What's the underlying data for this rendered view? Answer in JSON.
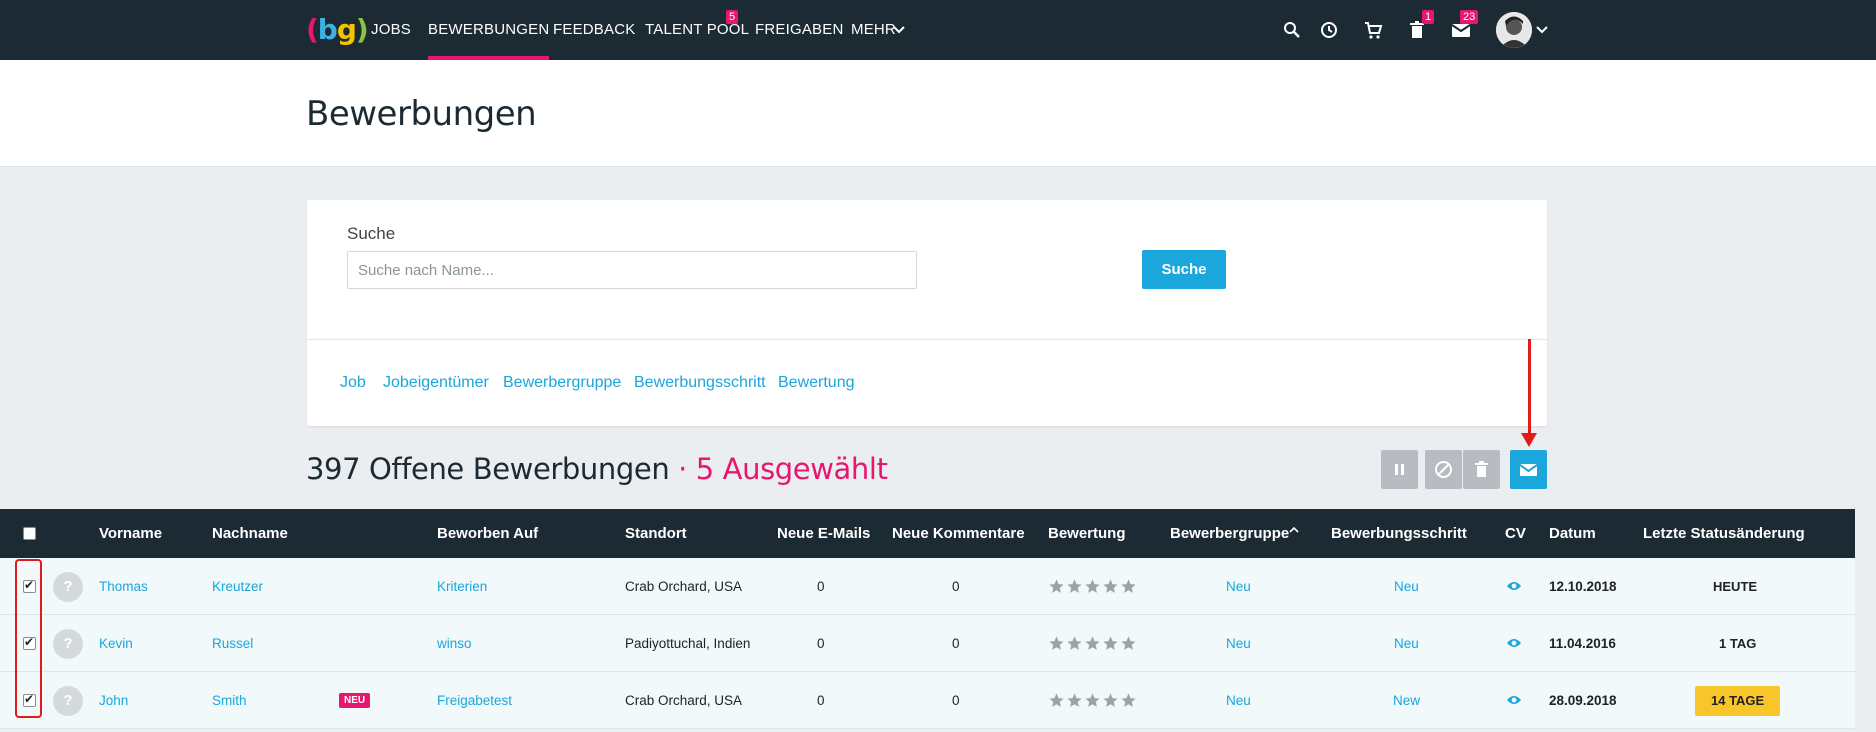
{
  "nav": {
    "items": [
      {
        "label": "JOBS",
        "active": false
      },
      {
        "label": "BEWERBUNGEN",
        "active": true
      },
      {
        "label": "FEEDBACK",
        "active": false
      },
      {
        "label": "TALENT POOL",
        "active": false,
        "badge": "5"
      },
      {
        "label": "FREIGABEN",
        "active": false
      },
      {
        "label": "MEHR",
        "active": false
      }
    ],
    "icons": [
      "search-icon",
      "clock-icon",
      "cart-icon",
      "trash-icon",
      "mail-icon",
      "avatar",
      "chevron-down-icon"
    ],
    "trash_badge": "1",
    "mail_badge": "23",
    "accent": "#e6176f",
    "bg": "#1c2b33"
  },
  "page": {
    "title": "Bewerbungen"
  },
  "search": {
    "label": "Suche",
    "placeholder": "Suche nach Name...",
    "button": "Suche"
  },
  "filters": [
    "Job",
    "Jobeigentümer",
    "Bewerbergruppe",
    "Bewerbungsschritt",
    "Bewertung"
  ],
  "summary": {
    "count_text": "397 Offene Bewerbungen",
    "separator": " · ",
    "selected_text": "5 Ausgewählt"
  },
  "actions": [
    "pause-icon",
    "block-icon",
    "trash-icon",
    "mail-icon"
  ],
  "table": {
    "headers": {
      "vorname": "Vorname",
      "nachname": "Nachname",
      "beworben": "Beworben Auf",
      "standort": "Standort",
      "emails": "Neue E-Mails",
      "kommentare": "Neue Kommentare",
      "bewertung": "Bewertung",
      "gruppe": "Bewerbergruppe",
      "schritt": "Bewerbungsschritt",
      "cv": "CV",
      "datum": "Datum",
      "status": "Letzte Statusänderung"
    },
    "rows": [
      {
        "checked": true,
        "avatar": "?",
        "vorname": "Thomas",
        "nachname": "Kreutzer",
        "neu": "",
        "beworben": "Kriterien",
        "standort": "Crab Orchard, USA",
        "emails": "0",
        "kommentare": "0",
        "rating": 0,
        "gruppe": "Neu",
        "schritt": "Neu",
        "datum": "12.10.2018",
        "status": "HEUTE",
        "status_highlight": false
      },
      {
        "checked": true,
        "avatar": "?",
        "vorname": "Kevin",
        "nachname": "Russel",
        "neu": "",
        "beworben": "winso",
        "standort": "Padiyottuchal, Indien",
        "emails": "0",
        "kommentare": "0",
        "rating": 0,
        "gruppe": "Neu",
        "schritt": "Neu",
        "datum": "11.04.2016",
        "status": "1 TAG",
        "status_highlight": false
      },
      {
        "checked": true,
        "avatar": "?",
        "vorname": "John",
        "nachname": "Smith",
        "neu": "NEU",
        "beworben": "Freigabetest",
        "standort": "Crab Orchard, USA",
        "emails": "0",
        "kommentare": "0",
        "rating": 0,
        "gruppe": "Neu",
        "schritt": "New",
        "datum": "28.09.2018",
        "status": "14 TAGE",
        "status_highlight": true
      }
    ]
  }
}
